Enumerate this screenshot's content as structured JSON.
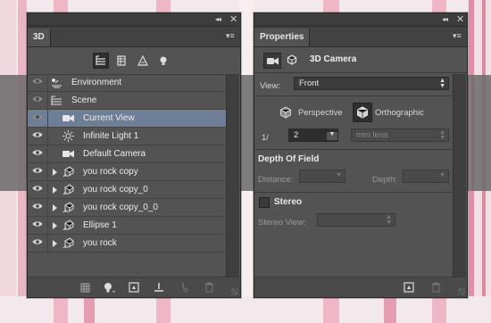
{
  "panel3d": {
    "tab_label": "3D",
    "filters": [
      "whole-scene-icon",
      "meshes-icon",
      "materials-icon",
      "lights-icon"
    ],
    "layers": [
      {
        "label": "Environment",
        "icon": "environment-icon",
        "expandable": false,
        "selected": false,
        "eye_dim": true
      },
      {
        "label": "Scene",
        "icon": "scene-icon",
        "expandable": false,
        "selected": false,
        "eye_dim": true
      },
      {
        "label": "Current View",
        "icon": "camera-icon",
        "expandable": false,
        "selected": true,
        "eye_dim": true
      },
      {
        "label": "Infinite Light 1",
        "icon": "infinite-light-icon",
        "expandable": false,
        "selected": false,
        "eye_dim": false
      },
      {
        "label": "Default Camera",
        "icon": "camera-icon",
        "expandable": false,
        "selected": false,
        "eye_dim": false
      },
      {
        "label": "you rock copy",
        "icon": "mesh-icon",
        "expandable": true,
        "selected": false,
        "eye_dim": false
      },
      {
        "label": "you rock copy_0",
        "icon": "mesh-icon",
        "expandable": true,
        "selected": false,
        "eye_dim": false
      },
      {
        "label": "you rock copy_0_0",
        "icon": "mesh-icon",
        "expandable": true,
        "selected": false,
        "eye_dim": false
      },
      {
        "label": "Ellipse 1",
        "icon": "mesh-icon",
        "expandable": true,
        "selected": false,
        "eye_dim": false
      },
      {
        "label": "you rock",
        "icon": "mesh-icon",
        "expandable": true,
        "selected": false,
        "eye_dim": false
      }
    ]
  },
  "properties": {
    "tab_label": "Properties",
    "header_title": "3D Camera",
    "view_label": "View:",
    "view_value": "Front",
    "perspective_label": "Perspective",
    "orthographic_label": "Orthographic",
    "fov_prefix": "1/",
    "fov_value": "2",
    "lens_unit": "mm lens",
    "dof_title": "Depth Of Field",
    "distance_label": "Distance:",
    "depth_label": "Depth:",
    "stereo_label": "Stereo",
    "stereo_view_label": "Stereo View:"
  },
  "colors": {
    "panel_bg": "#535353",
    "selected_row": "#6d7e96",
    "backdrop_pink": "#e8a8b8"
  }
}
